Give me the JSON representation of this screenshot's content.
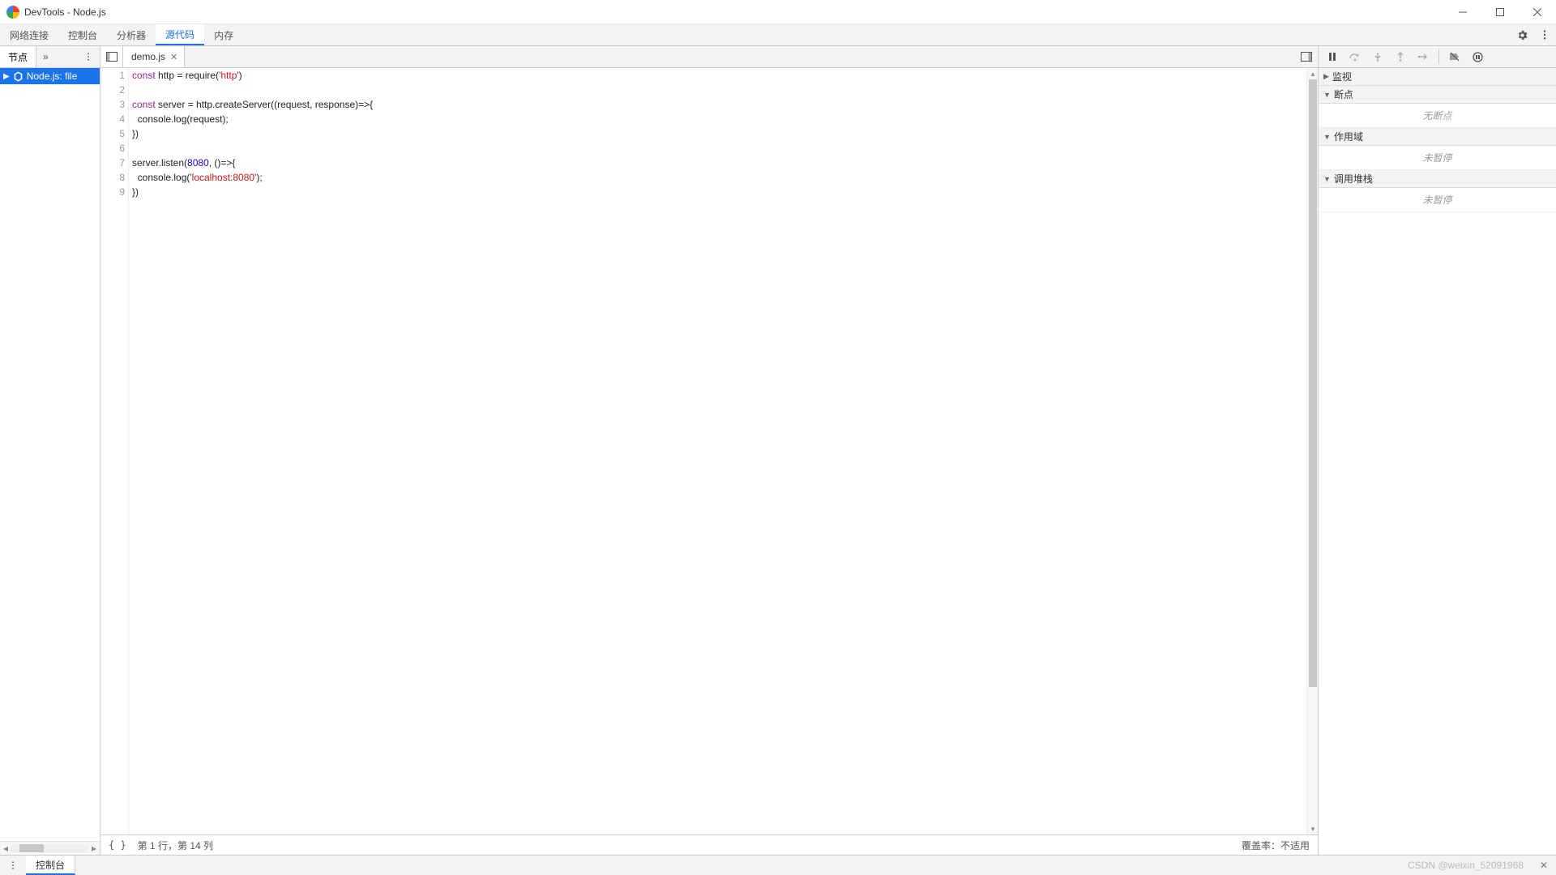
{
  "window": {
    "title": "DevTools - Node.js"
  },
  "main_tabs": {
    "items": [
      "网络连接",
      "控制台",
      "分析器",
      "源代码",
      "内存"
    ],
    "active_index": 3
  },
  "navigator": {
    "tab_label": "节点",
    "tree_item": "Node.js:  file"
  },
  "file_tabs": {
    "items": [
      {
        "name": "demo.js"
      }
    ]
  },
  "code": {
    "lines": [
      [
        {
          "t": "const ",
          "c": "kw"
        },
        {
          "t": "http = require("
        },
        {
          "t": "'http'",
          "c": "str"
        },
        {
          "t": ")"
        }
      ],
      [
        {
          "t": ""
        }
      ],
      [
        {
          "t": "const ",
          "c": "kw"
        },
        {
          "t": "server = http.createServer((request, response)=>{"
        }
      ],
      [
        {
          "t": "  console.log(request);"
        }
      ],
      [
        {
          "t": "})"
        }
      ],
      [
        {
          "t": ""
        }
      ],
      [
        {
          "t": "server.listen("
        },
        {
          "t": "8080",
          "c": "num"
        },
        {
          "t": ", ()=>{"
        }
      ],
      [
        {
          "t": "  console.log("
        },
        {
          "t": "'localhost:8080'",
          "c": "str"
        },
        {
          "t": ");"
        }
      ],
      [
        {
          "t": "})"
        }
      ]
    ]
  },
  "editor_status": {
    "braces": "{ }",
    "cursor": "第 1 行，第 14 列",
    "coverage": "覆盖率：不适用"
  },
  "debugger": {
    "sections": {
      "watch": {
        "label": "监视"
      },
      "breakpoints": {
        "label": "断点",
        "body": "无断点"
      },
      "scope": {
        "label": "作用域",
        "body": "未暂停"
      },
      "callstack": {
        "label": "调用堆栈",
        "body": "未暂停"
      }
    }
  },
  "drawer": {
    "tab": "控制台",
    "watermark": "CSDN @weixin_52091968"
  }
}
